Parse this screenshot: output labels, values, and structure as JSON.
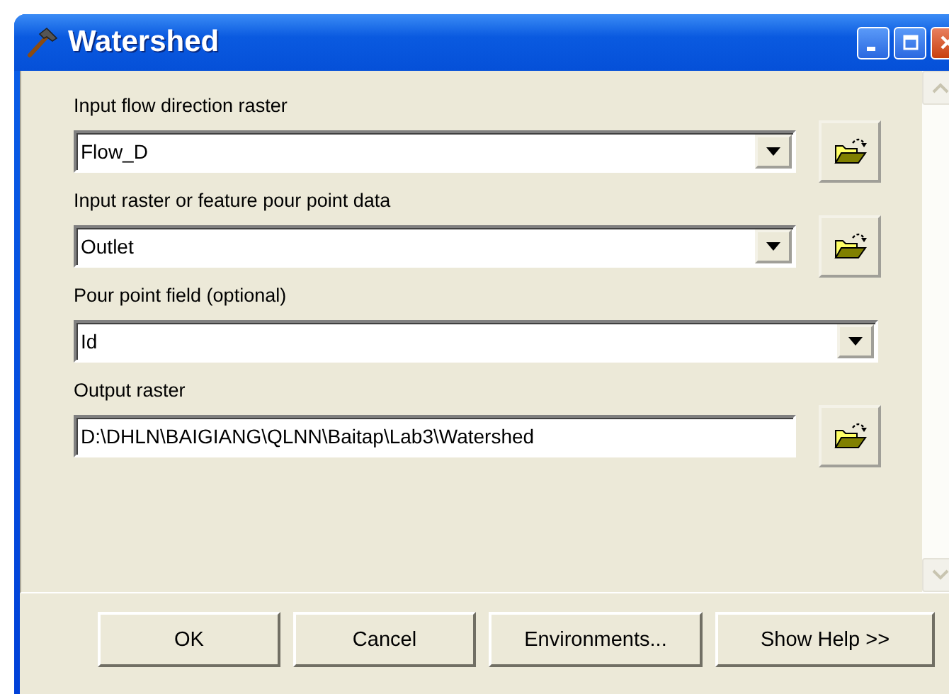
{
  "window": {
    "title": "Watershed"
  },
  "fields": [
    {
      "kind": "dropdown",
      "label": "Input flow direction raster",
      "value": "Flow_D",
      "browse": true
    },
    {
      "kind": "dropdown",
      "label": "Input raster or feature pour point data",
      "value": "Outlet",
      "browse": true
    },
    {
      "kind": "dropdown",
      "label": "Pour point field (optional)",
      "value": "Id",
      "browse": false
    },
    {
      "kind": "text",
      "label": "Output raster",
      "value": "D:\\DHLN\\BAIGIANG\\QLNN\\Baitap\\Lab3\\Watershed",
      "browse": true
    }
  ],
  "buttons": [
    "OK",
    "Cancel",
    "Environments...",
    "Show Help >>"
  ]
}
